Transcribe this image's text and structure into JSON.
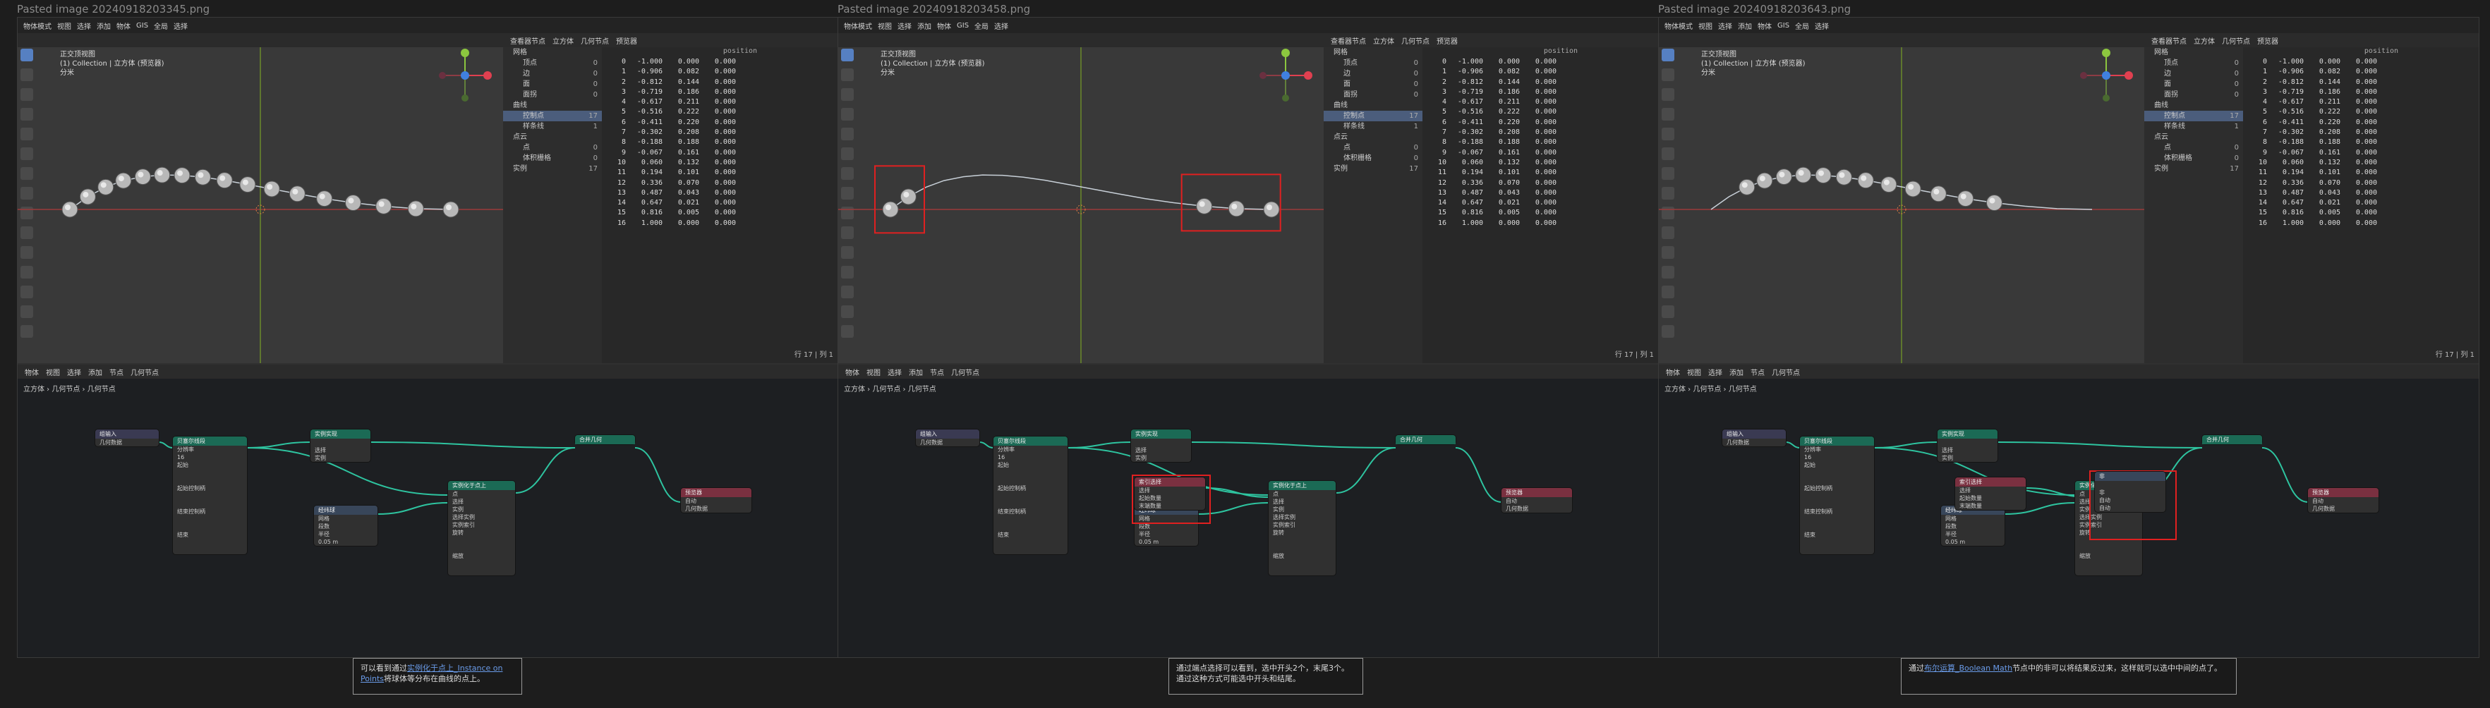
{
  "panels": [
    {
      "title": "Pasted image 20240918203345.png"
    },
    {
      "title": "Pasted image 20240918203458.png"
    },
    {
      "title": "Pasted image 20240918203643.png"
    }
  ],
  "topbar": {
    "mode": "物体模式",
    "menus": [
      "视图",
      "选择",
      "添加",
      "物体",
      "GIS"
    ],
    "pivot": "全局",
    "select": "选择"
  },
  "viewport": {
    "line1": "正交顶视图",
    "line2": "(1) Collection | 立方体 (预览器)",
    "line3": "分米"
  },
  "spreadsheet": {
    "header": [
      "查看器节点",
      "立方体",
      "几何节点",
      "预览器"
    ],
    "tree": [
      {
        "label": "网格",
        "count": ""
      },
      {
        "label": "顶点",
        "count": "0"
      },
      {
        "label": "边",
        "count": "0"
      },
      {
        "label": "面",
        "count": "0"
      },
      {
        "label": "面拐",
        "count": "0"
      },
      {
        "label": "曲线",
        "count": ""
      },
      {
        "label": "控制点",
        "count": "17"
      },
      {
        "label": "样条线",
        "count": "1"
      },
      {
        "label": "点云",
        "count": ""
      },
      {
        "label": "点",
        "count": "0"
      },
      {
        "label": "体积栅格",
        "count": "0"
      },
      {
        "label": "实例",
        "count": "17"
      }
    ],
    "column": "position",
    "rows": [
      [
        "0",
        "-1.000",
        "0.000",
        "0.000"
      ],
      [
        "1",
        "-0.906",
        "0.082",
        "0.000"
      ],
      [
        "2",
        "-0.812",
        "0.144",
        "0.000"
      ],
      [
        "3",
        "-0.719",
        "0.186",
        "0.000"
      ],
      [
        "4",
        "-0.617",
        "0.211",
        "0.000"
      ],
      [
        "5",
        "-0.516",
        "0.222",
        "0.000"
      ],
      [
        "6",
        "-0.411",
        "0.220",
        "0.000"
      ],
      [
        "7",
        "-0.302",
        "0.208",
        "0.000"
      ],
      [
        "8",
        "-0.188",
        "0.188",
        "0.000"
      ],
      [
        "9",
        "-0.067",
        "0.161",
        "0.000"
      ],
      [
        "10",
        "0.060",
        "0.132",
        "0.000"
      ],
      [
        "11",
        "0.194",
        "0.101",
        "0.000"
      ],
      [
        "12",
        "0.336",
        "0.070",
        "0.000"
      ],
      [
        "13",
        "0.487",
        "0.043",
        "0.000"
      ],
      [
        "14",
        "0.647",
        "0.021",
        "0.000"
      ],
      [
        "15",
        "0.816",
        "0.005",
        "0.000"
      ],
      [
        "16",
        "1.000",
        "0.000",
        "0.000"
      ]
    ],
    "footer": "行 17 | 列 1"
  },
  "node_editor": {
    "header": [
      "物体",
      "视图",
      "选择",
      "添加",
      "节点",
      "几何节点"
    ],
    "breadcrumb": "立方体 › 几何节点 › 几何节点",
    "nodes": {
      "group_input": "组输入",
      "geometry": "几何数据",
      "curve_line": "贝塞尔线段",
      "resolution": "分辨率",
      "res_value": "16",
      "start": "起始",
      "start_handle": "起始控制柄",
      "end_handle": "结束控制柄",
      "end": "结束",
      "realize": "实例实现",
      "instance_on_points": "实例化于点上",
      "points": "点",
      "selection": "选择",
      "instance": "实例",
      "pick_instance": "选择实例",
      "instance_index": "实例索引",
      "rotation": "旋转",
      "scale": "缩放",
      "uv_sphere": "经纬球",
      "segments": "段数",
      "radius": "半径",
      "radius_val": "0.05 m",
      "join": "合并几何",
      "viewer": "预览器",
      "auto": "自动",
      "index_selection": "索引选择",
      "start_count": "起始数量",
      "end_count": "末端数量",
      "boolean_math": "非",
      "mesh": "网格"
    }
  },
  "captions": [
    {
      "pre": "可以看到通过",
      "link": "实例化于点上_Instance on Points",
      "post": "将球体等分布在曲线的点上。"
    },
    {
      "pre": "通过端点选择可以看到，选中开头2个，末尾3个。通过这种方式可能选中开头和结尾。",
      "link": "",
      "post": ""
    },
    {
      "pre": "通过",
      "link": "布尔运算_Boolean Math",
      "post": "节点中的非可以将结果反过来，这样就可以选中中间的点了。"
    }
  ]
}
